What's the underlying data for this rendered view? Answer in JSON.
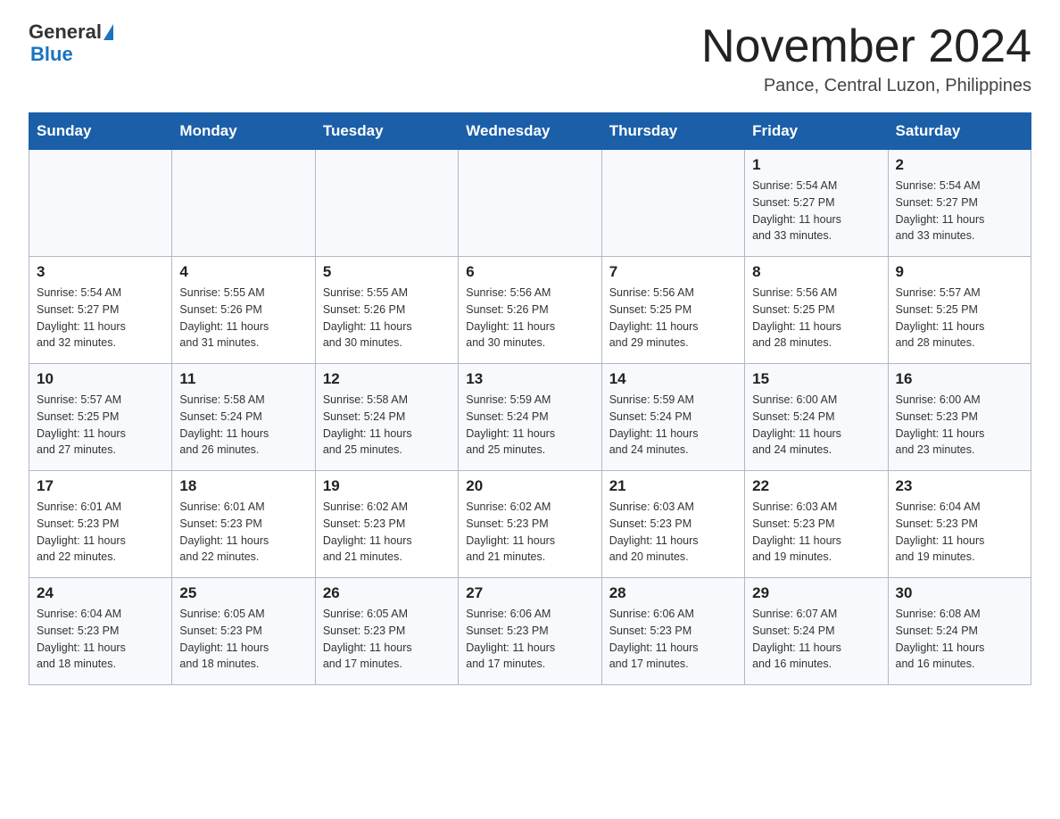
{
  "logo": {
    "general_text": "General",
    "blue_text": "Blue"
  },
  "header": {
    "month_title": "November 2024",
    "subtitle": "Pance, Central Luzon, Philippines"
  },
  "weekdays": [
    "Sunday",
    "Monday",
    "Tuesday",
    "Wednesday",
    "Thursday",
    "Friday",
    "Saturday"
  ],
  "weeks": [
    [
      {
        "day": "",
        "info": ""
      },
      {
        "day": "",
        "info": ""
      },
      {
        "day": "",
        "info": ""
      },
      {
        "day": "",
        "info": ""
      },
      {
        "day": "",
        "info": ""
      },
      {
        "day": "1",
        "info": "Sunrise: 5:54 AM\nSunset: 5:27 PM\nDaylight: 11 hours\nand 33 minutes."
      },
      {
        "day": "2",
        "info": "Sunrise: 5:54 AM\nSunset: 5:27 PM\nDaylight: 11 hours\nand 33 minutes."
      }
    ],
    [
      {
        "day": "3",
        "info": "Sunrise: 5:54 AM\nSunset: 5:27 PM\nDaylight: 11 hours\nand 32 minutes."
      },
      {
        "day": "4",
        "info": "Sunrise: 5:55 AM\nSunset: 5:26 PM\nDaylight: 11 hours\nand 31 minutes."
      },
      {
        "day": "5",
        "info": "Sunrise: 5:55 AM\nSunset: 5:26 PM\nDaylight: 11 hours\nand 30 minutes."
      },
      {
        "day": "6",
        "info": "Sunrise: 5:56 AM\nSunset: 5:26 PM\nDaylight: 11 hours\nand 30 minutes."
      },
      {
        "day": "7",
        "info": "Sunrise: 5:56 AM\nSunset: 5:25 PM\nDaylight: 11 hours\nand 29 minutes."
      },
      {
        "day": "8",
        "info": "Sunrise: 5:56 AM\nSunset: 5:25 PM\nDaylight: 11 hours\nand 28 minutes."
      },
      {
        "day": "9",
        "info": "Sunrise: 5:57 AM\nSunset: 5:25 PM\nDaylight: 11 hours\nand 28 minutes."
      }
    ],
    [
      {
        "day": "10",
        "info": "Sunrise: 5:57 AM\nSunset: 5:25 PM\nDaylight: 11 hours\nand 27 minutes."
      },
      {
        "day": "11",
        "info": "Sunrise: 5:58 AM\nSunset: 5:24 PM\nDaylight: 11 hours\nand 26 minutes."
      },
      {
        "day": "12",
        "info": "Sunrise: 5:58 AM\nSunset: 5:24 PM\nDaylight: 11 hours\nand 25 minutes."
      },
      {
        "day": "13",
        "info": "Sunrise: 5:59 AM\nSunset: 5:24 PM\nDaylight: 11 hours\nand 25 minutes."
      },
      {
        "day": "14",
        "info": "Sunrise: 5:59 AM\nSunset: 5:24 PM\nDaylight: 11 hours\nand 24 minutes."
      },
      {
        "day": "15",
        "info": "Sunrise: 6:00 AM\nSunset: 5:24 PM\nDaylight: 11 hours\nand 24 minutes."
      },
      {
        "day": "16",
        "info": "Sunrise: 6:00 AM\nSunset: 5:23 PM\nDaylight: 11 hours\nand 23 minutes."
      }
    ],
    [
      {
        "day": "17",
        "info": "Sunrise: 6:01 AM\nSunset: 5:23 PM\nDaylight: 11 hours\nand 22 minutes."
      },
      {
        "day": "18",
        "info": "Sunrise: 6:01 AM\nSunset: 5:23 PM\nDaylight: 11 hours\nand 22 minutes."
      },
      {
        "day": "19",
        "info": "Sunrise: 6:02 AM\nSunset: 5:23 PM\nDaylight: 11 hours\nand 21 minutes."
      },
      {
        "day": "20",
        "info": "Sunrise: 6:02 AM\nSunset: 5:23 PM\nDaylight: 11 hours\nand 21 minutes."
      },
      {
        "day": "21",
        "info": "Sunrise: 6:03 AM\nSunset: 5:23 PM\nDaylight: 11 hours\nand 20 minutes."
      },
      {
        "day": "22",
        "info": "Sunrise: 6:03 AM\nSunset: 5:23 PM\nDaylight: 11 hours\nand 19 minutes."
      },
      {
        "day": "23",
        "info": "Sunrise: 6:04 AM\nSunset: 5:23 PM\nDaylight: 11 hours\nand 19 minutes."
      }
    ],
    [
      {
        "day": "24",
        "info": "Sunrise: 6:04 AM\nSunset: 5:23 PM\nDaylight: 11 hours\nand 18 minutes."
      },
      {
        "day": "25",
        "info": "Sunrise: 6:05 AM\nSunset: 5:23 PM\nDaylight: 11 hours\nand 18 minutes."
      },
      {
        "day": "26",
        "info": "Sunrise: 6:05 AM\nSunset: 5:23 PM\nDaylight: 11 hours\nand 17 minutes."
      },
      {
        "day": "27",
        "info": "Sunrise: 6:06 AM\nSunset: 5:23 PM\nDaylight: 11 hours\nand 17 minutes."
      },
      {
        "day": "28",
        "info": "Sunrise: 6:06 AM\nSunset: 5:23 PM\nDaylight: 11 hours\nand 17 minutes."
      },
      {
        "day": "29",
        "info": "Sunrise: 6:07 AM\nSunset: 5:24 PM\nDaylight: 11 hours\nand 16 minutes."
      },
      {
        "day": "30",
        "info": "Sunrise: 6:08 AM\nSunset: 5:24 PM\nDaylight: 11 hours\nand 16 minutes."
      }
    ]
  ]
}
